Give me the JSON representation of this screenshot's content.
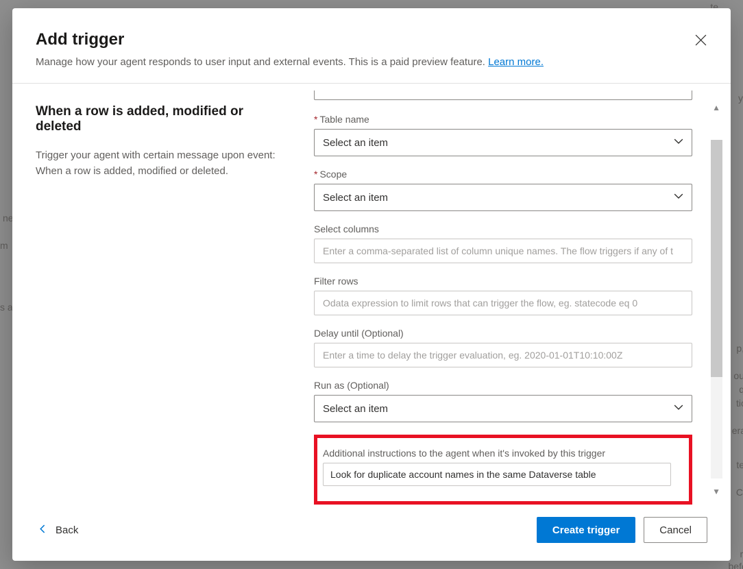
{
  "header": {
    "title": "Add trigger",
    "subtitle_pre": "Manage how your agent responds to user input and external events. This is a paid preview feature. ",
    "learn_more": "Learn more."
  },
  "left": {
    "title": "When a row is added, modified or deleted",
    "desc": "Trigger your agent with certain message upon event: When a row is added, modified or deleted."
  },
  "form": {
    "table_name": {
      "label": "Table name",
      "placeholder": "Select an item"
    },
    "scope": {
      "label": "Scope",
      "placeholder": "Select an item"
    },
    "select_columns": {
      "label": "Select columns",
      "placeholder": "Enter a comma-separated list of column unique names. The flow triggers if any of t"
    },
    "filter_rows": {
      "label": "Filter rows",
      "placeholder": "Odata expression to limit rows that can trigger the flow, eg. statecode eq 0"
    },
    "delay_until": {
      "label": "Delay until (Optional)",
      "placeholder": "Enter a time to delay the trigger evaluation, eg. 2020-01-01T10:10:00Z"
    },
    "run_as": {
      "label": "Run as (Optional)",
      "placeholder": "Select an item"
    },
    "instructions": {
      "label": "Additional instructions to the agent when it's invoked by this trigger",
      "value": "Look for duplicate account names in the same Dataverse table"
    }
  },
  "footer": {
    "back": "Back",
    "create": "Create trigger",
    "cancel": "Cancel"
  },
  "required_star": "*"
}
